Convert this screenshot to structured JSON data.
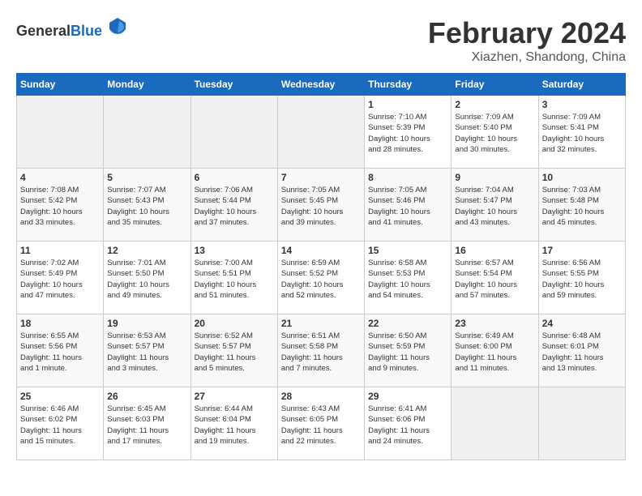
{
  "header": {
    "logo_general": "General",
    "logo_blue": "Blue",
    "title": "February 2024",
    "subtitle": "Xiazhen, Shandong, China"
  },
  "days_of_week": [
    "Sunday",
    "Monday",
    "Tuesday",
    "Wednesday",
    "Thursday",
    "Friday",
    "Saturday"
  ],
  "weeks": [
    [
      {
        "day": "",
        "info": ""
      },
      {
        "day": "",
        "info": ""
      },
      {
        "day": "",
        "info": ""
      },
      {
        "day": "",
        "info": ""
      },
      {
        "day": "1",
        "info": "Sunrise: 7:10 AM\nSunset: 5:39 PM\nDaylight: 10 hours\nand 28 minutes."
      },
      {
        "day": "2",
        "info": "Sunrise: 7:09 AM\nSunset: 5:40 PM\nDaylight: 10 hours\nand 30 minutes."
      },
      {
        "day": "3",
        "info": "Sunrise: 7:09 AM\nSunset: 5:41 PM\nDaylight: 10 hours\nand 32 minutes."
      }
    ],
    [
      {
        "day": "4",
        "info": "Sunrise: 7:08 AM\nSunset: 5:42 PM\nDaylight: 10 hours\nand 33 minutes."
      },
      {
        "day": "5",
        "info": "Sunrise: 7:07 AM\nSunset: 5:43 PM\nDaylight: 10 hours\nand 35 minutes."
      },
      {
        "day": "6",
        "info": "Sunrise: 7:06 AM\nSunset: 5:44 PM\nDaylight: 10 hours\nand 37 minutes."
      },
      {
        "day": "7",
        "info": "Sunrise: 7:05 AM\nSunset: 5:45 PM\nDaylight: 10 hours\nand 39 minutes."
      },
      {
        "day": "8",
        "info": "Sunrise: 7:05 AM\nSunset: 5:46 PM\nDaylight: 10 hours\nand 41 minutes."
      },
      {
        "day": "9",
        "info": "Sunrise: 7:04 AM\nSunset: 5:47 PM\nDaylight: 10 hours\nand 43 minutes."
      },
      {
        "day": "10",
        "info": "Sunrise: 7:03 AM\nSunset: 5:48 PM\nDaylight: 10 hours\nand 45 minutes."
      }
    ],
    [
      {
        "day": "11",
        "info": "Sunrise: 7:02 AM\nSunset: 5:49 PM\nDaylight: 10 hours\nand 47 minutes."
      },
      {
        "day": "12",
        "info": "Sunrise: 7:01 AM\nSunset: 5:50 PM\nDaylight: 10 hours\nand 49 minutes."
      },
      {
        "day": "13",
        "info": "Sunrise: 7:00 AM\nSunset: 5:51 PM\nDaylight: 10 hours\nand 51 minutes."
      },
      {
        "day": "14",
        "info": "Sunrise: 6:59 AM\nSunset: 5:52 PM\nDaylight: 10 hours\nand 52 minutes."
      },
      {
        "day": "15",
        "info": "Sunrise: 6:58 AM\nSunset: 5:53 PM\nDaylight: 10 hours\nand 54 minutes."
      },
      {
        "day": "16",
        "info": "Sunrise: 6:57 AM\nSunset: 5:54 PM\nDaylight: 10 hours\nand 57 minutes."
      },
      {
        "day": "17",
        "info": "Sunrise: 6:56 AM\nSunset: 5:55 PM\nDaylight: 10 hours\nand 59 minutes."
      }
    ],
    [
      {
        "day": "18",
        "info": "Sunrise: 6:55 AM\nSunset: 5:56 PM\nDaylight: 11 hours\nand 1 minute."
      },
      {
        "day": "19",
        "info": "Sunrise: 6:53 AM\nSunset: 5:57 PM\nDaylight: 11 hours\nand 3 minutes."
      },
      {
        "day": "20",
        "info": "Sunrise: 6:52 AM\nSunset: 5:57 PM\nDaylight: 11 hours\nand 5 minutes."
      },
      {
        "day": "21",
        "info": "Sunrise: 6:51 AM\nSunset: 5:58 PM\nDaylight: 11 hours\nand 7 minutes."
      },
      {
        "day": "22",
        "info": "Sunrise: 6:50 AM\nSunset: 5:59 PM\nDaylight: 11 hours\nand 9 minutes."
      },
      {
        "day": "23",
        "info": "Sunrise: 6:49 AM\nSunset: 6:00 PM\nDaylight: 11 hours\nand 11 minutes."
      },
      {
        "day": "24",
        "info": "Sunrise: 6:48 AM\nSunset: 6:01 PM\nDaylight: 11 hours\nand 13 minutes."
      }
    ],
    [
      {
        "day": "25",
        "info": "Sunrise: 6:46 AM\nSunset: 6:02 PM\nDaylight: 11 hours\nand 15 minutes."
      },
      {
        "day": "26",
        "info": "Sunrise: 6:45 AM\nSunset: 6:03 PM\nDaylight: 11 hours\nand 17 minutes."
      },
      {
        "day": "27",
        "info": "Sunrise: 6:44 AM\nSunset: 6:04 PM\nDaylight: 11 hours\nand 19 minutes."
      },
      {
        "day": "28",
        "info": "Sunrise: 6:43 AM\nSunset: 6:05 PM\nDaylight: 11 hours\nand 22 minutes."
      },
      {
        "day": "29",
        "info": "Sunrise: 6:41 AM\nSunset: 6:06 PM\nDaylight: 11 hours\nand 24 minutes."
      },
      {
        "day": "",
        "info": ""
      },
      {
        "day": "",
        "info": ""
      }
    ]
  ]
}
